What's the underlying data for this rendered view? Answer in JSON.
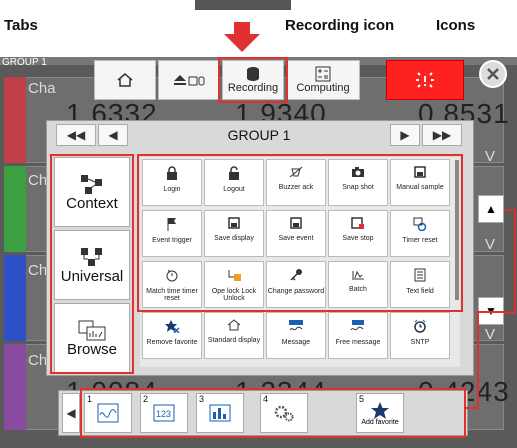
{
  "annotations": {
    "tabs": "Tabs",
    "recording_icon": "Recording icon",
    "icons": "Icons"
  },
  "background": {
    "group_label": "GROUP 1",
    "channel_label": "Cha",
    "unit": "V",
    "numbers": [
      "1.6332",
      "1.9340",
      "0.8531",
      "1.0084",
      "1.2344",
      "0.4243"
    ]
  },
  "top_toolbar": {
    "recording": "Recording",
    "computing": "Computing"
  },
  "panel": {
    "group_title": "GROUP 1"
  },
  "tabs": [
    {
      "label": "Context",
      "icon": "context-icon"
    },
    {
      "label": "Universal",
      "icon": "universal-icon"
    },
    {
      "label": "Browse",
      "icon": "browse-icon"
    }
  ],
  "icons": [
    {
      "label": "Login",
      "icon": "lock-icon"
    },
    {
      "label": "Logout",
      "icon": "unlock-icon"
    },
    {
      "label": "Buzzer ack",
      "icon": "buzzer-icon"
    },
    {
      "label": "Snap shot",
      "icon": "camera-icon"
    },
    {
      "label": "Manual sample",
      "icon": "save-icon"
    },
    {
      "label": "Event trigger",
      "icon": "flag-icon"
    },
    {
      "label": "Save display",
      "icon": "save-icon"
    },
    {
      "label": "Save event",
      "icon": "save-icon"
    },
    {
      "label": "Save stop",
      "icon": "save-stop-icon"
    },
    {
      "label": "Timer reset",
      "icon": "timer-reset-icon"
    },
    {
      "label": "Match time timer reset",
      "icon": "match-timer-icon"
    },
    {
      "label": "Ope lock Lock Unlock",
      "icon": "ope-lock-icon"
    },
    {
      "label": "Change password",
      "icon": "key-icon"
    },
    {
      "label": "Batch",
      "icon": "batch-icon"
    },
    {
      "label": "Text field",
      "icon": "text-field-icon"
    },
    {
      "label": "Remove favorite",
      "icon": "remove-favorite-icon"
    },
    {
      "label": "Standard display",
      "icon": "home-icon"
    },
    {
      "label": "Message",
      "icon": "message-icon"
    },
    {
      "label": "Free message",
      "icon": "free-message-icon"
    },
    {
      "label": "SNTP",
      "icon": "sntp-icon"
    }
  ],
  "favorites": [
    {
      "num": "1",
      "label": ""
    },
    {
      "num": "2",
      "label": ""
    },
    {
      "num": "3",
      "label": ""
    },
    {
      "num": "4",
      "label": ""
    },
    {
      "num": "5",
      "label": "Add favorite"
    }
  ],
  "colors": {
    "annotation_red": "#e03030",
    "alarm_red": "#ff2020",
    "accent_blue": "#1a5fb4"
  }
}
